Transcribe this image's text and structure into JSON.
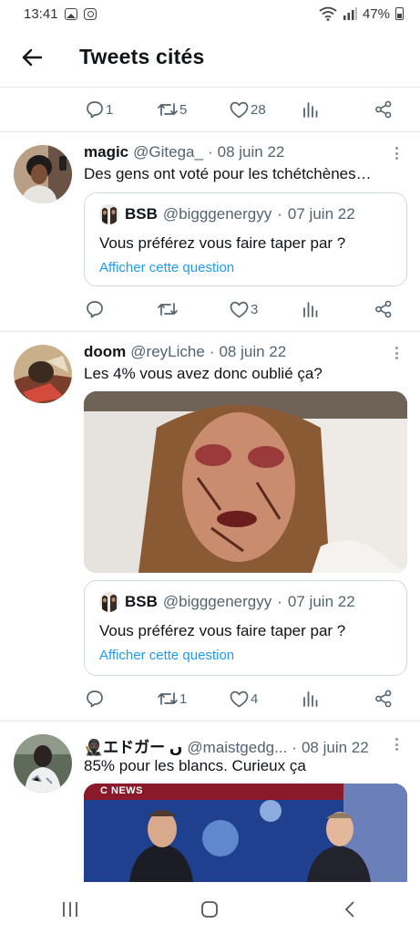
{
  "status_bar": {
    "time": "13:41",
    "battery": "47%",
    "icons": [
      "gallery-icon",
      "instagram-icon",
      "wifi-icon",
      "signal-icon",
      "battery-icon"
    ]
  },
  "header": {
    "title": "Tweets cités",
    "back_icon": "arrow-left-icon"
  },
  "top_actions": {
    "replies": "1",
    "retweets": "5",
    "likes": "28"
  },
  "tweets": [
    {
      "name": "magic",
      "handle": "@Gitega_",
      "dot": "·",
      "date": "08 juin 22",
      "text": "Des gens ont voté pour les tchétchènes…",
      "quote": {
        "name": "BSB",
        "handle": "@bigggenergyy",
        "dot": "·",
        "date": "07 juin 22",
        "text": "Vous préférez vous faire taper par ?",
        "link": "Afficher cette question"
      },
      "actions": {
        "replies": "",
        "retweets": "",
        "likes": "3"
      }
    },
    {
      "name": "doom",
      "handle": "@reyLiche",
      "dot": "·",
      "date": "08 juin 22",
      "text": "Les 4% vous avez donc oublié ça?",
      "quote": {
        "name": "BSB",
        "handle": "@bigggenergyy",
        "dot": "·",
        "date": "07 juin 22",
        "text": "Vous préférez vous faire taper par ?",
        "link": "Afficher cette question"
      },
      "actions": {
        "replies": "",
        "retweets": "1",
        "likes": "4"
      }
    },
    {
      "name": "🥷🏿エドガー ں",
      "handle": "@maistgedg...",
      "dot": "·",
      "date": "08 juin 22",
      "text": "85% pour les blancs. Curieux ça",
      "media_label": "C NEWS"
    }
  ],
  "colors": {
    "accent": "#1d9bf0",
    "secondary_text": "#536471",
    "divider": "#e6e9ea"
  }
}
